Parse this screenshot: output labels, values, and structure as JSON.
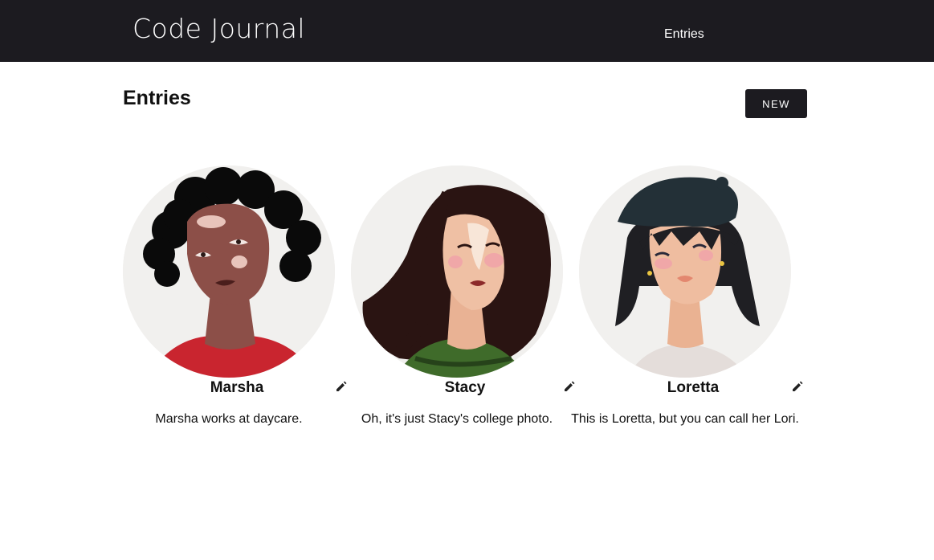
{
  "header": {
    "brand": "Code Journal",
    "nav": {
      "entries_label": "Entries"
    }
  },
  "main": {
    "title": "Entries",
    "new_button_label": "NEW",
    "entries": [
      {
        "name": "Marsha",
        "description": "Marsha works at daycare.",
        "edit_icon": "pencil-icon"
      },
      {
        "name": "Stacy",
        "description": "Oh, it's just Stacy's college photo.",
        "edit_icon": "pencil-icon"
      },
      {
        "name": "Loretta",
        "description": "This is Loretta, but you can call her Lori.",
        "edit_icon": "pencil-icon"
      }
    ]
  },
  "colors": {
    "header_bg": "#1c1b20",
    "button_bg": "#1c1b20",
    "avatar_bg": "#f1f0ee"
  }
}
